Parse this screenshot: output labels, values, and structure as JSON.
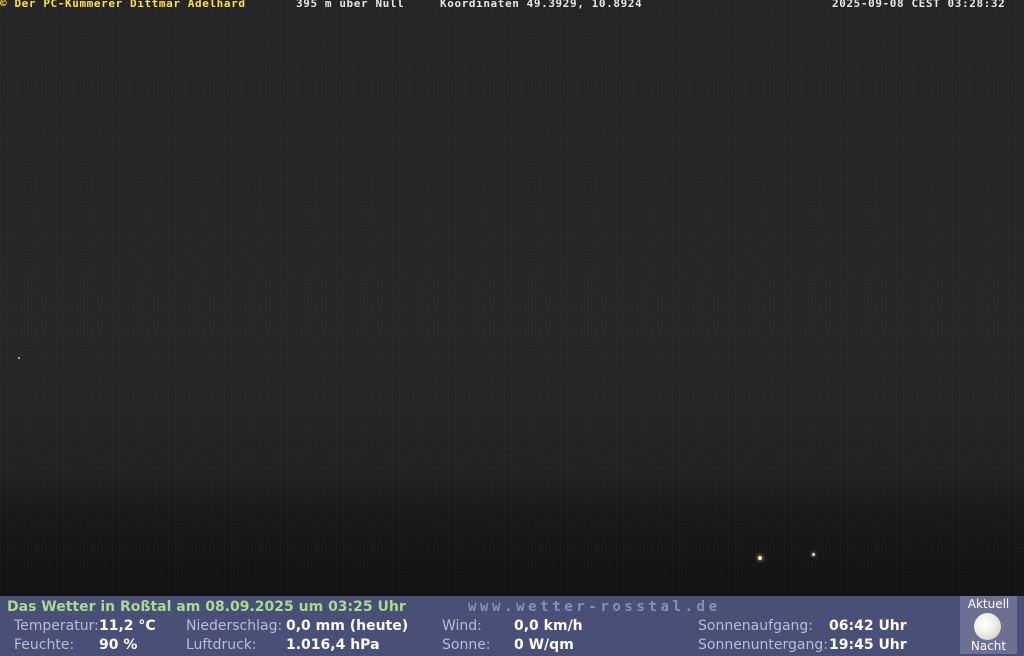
{
  "header": {
    "left": "© Der PC-Kümmerer Dittmar Adelhard",
    "altitude": "395 m über Null",
    "coordinates": "Koordinaten 49.3929, 10.8924",
    "datetime": "2025-09-08 CEST 03:28:32"
  },
  "weather": {
    "title": "Das Wetter in Roßtal am 08.09.2025 um 03:25 Uhr",
    "website": "www.wetter-rosstal.de",
    "temperature_label": "Temperatur:",
    "temperature_value": "11,2 °C",
    "humidity_label": "Feuchte:",
    "humidity_value": "90 %",
    "precipitation_label": "Niederschlag:",
    "precipitation_value": "0,0 mm (heute)",
    "pressure_label": "Luftdruck:",
    "pressure_value": "1.016,4 hPa",
    "wind_label": "Wind:",
    "wind_value": "0,0 km/h",
    "sun_label": "Sonne:",
    "sun_value": "0 W/qm",
    "sunrise_label": "Sonnenaufgang:",
    "sunrise_value": "06:42 Uhr",
    "sunset_label": "Sonnenuntergang:",
    "sunset_value": "19:45 Uhr"
  },
  "moon": {
    "top_label": "Aktuell",
    "bottom_label": "Nacht",
    "icon": "full-moon-icon"
  },
  "colors": {
    "header_yellow": "#ffe430",
    "bar_background": "#4a4f78",
    "title_green": "#a6dd8c"
  }
}
